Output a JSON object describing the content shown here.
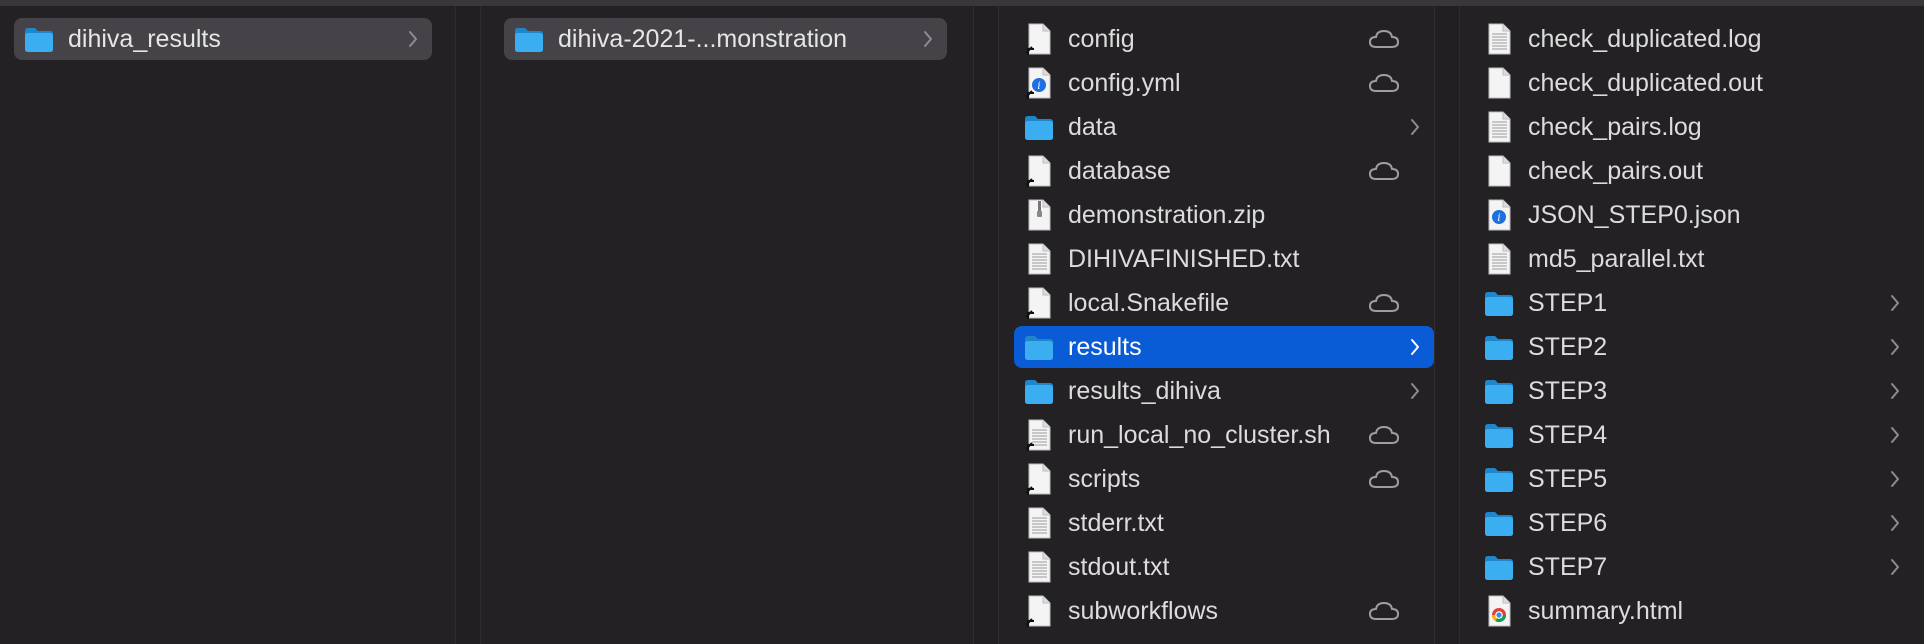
{
  "columns": [
    {
      "items": [
        {
          "name": "dihiva_results",
          "kind": "folder",
          "chevron": true,
          "selected": "path"
        }
      ]
    },
    {
      "items": [
        {
          "name": "dihiva-2021-...monstration",
          "kind": "folder",
          "chevron": true,
          "selected": "path"
        }
      ]
    },
    {
      "items": [
        {
          "name": "config",
          "kind": "alias",
          "cloud": true
        },
        {
          "name": "config.yml",
          "kind": "yml-alias",
          "cloud": true
        },
        {
          "name": "data",
          "kind": "folder",
          "chevron": true
        },
        {
          "name": "database",
          "kind": "alias",
          "cloud": true
        },
        {
          "name": "demonstration.zip",
          "kind": "zip"
        },
        {
          "name": "DIHIVAFINISHED.txt",
          "kind": "text"
        },
        {
          "name": "local.Snakefile",
          "kind": "alias",
          "cloud": true
        },
        {
          "name": "results",
          "kind": "folder",
          "chevron": true,
          "selected": "active"
        },
        {
          "name": "results_dihiva",
          "kind": "folder",
          "chevron": true
        },
        {
          "name": "run_local_no_cluster.sh",
          "kind": "text-alias",
          "cloud": true
        },
        {
          "name": "scripts",
          "kind": "alias",
          "cloud": true
        },
        {
          "name": "stderr.txt",
          "kind": "text"
        },
        {
          "name": "stdout.txt",
          "kind": "text"
        },
        {
          "name": "subworkflows",
          "kind": "alias",
          "cloud": true
        }
      ]
    },
    {
      "items": [
        {
          "name": "check_duplicated.log",
          "kind": "text"
        },
        {
          "name": "check_duplicated.out",
          "kind": "doc"
        },
        {
          "name": "check_pairs.log",
          "kind": "text"
        },
        {
          "name": "check_pairs.out",
          "kind": "doc"
        },
        {
          "name": "JSON_STEP0.json",
          "kind": "json"
        },
        {
          "name": "md5_parallel.txt",
          "kind": "text"
        },
        {
          "name": "STEP1",
          "kind": "folder",
          "chevron": true
        },
        {
          "name": "STEP2",
          "kind": "folder",
          "chevron": true
        },
        {
          "name": "STEP3",
          "kind": "folder",
          "chevron": true
        },
        {
          "name": "STEP4",
          "kind": "folder",
          "chevron": true
        },
        {
          "name": "STEP5",
          "kind": "folder",
          "chevron": true
        },
        {
          "name": "STEP6",
          "kind": "folder",
          "chevron": true
        },
        {
          "name": "STEP7",
          "kind": "folder",
          "chevron": true
        },
        {
          "name": "summary.html",
          "kind": "html"
        }
      ]
    }
  ],
  "colors": {
    "background": "#242125",
    "path_selection": "#464348",
    "active_selection": "#0a5bd6",
    "folder": "#3aaef0",
    "text": "#dcdcdc"
  }
}
